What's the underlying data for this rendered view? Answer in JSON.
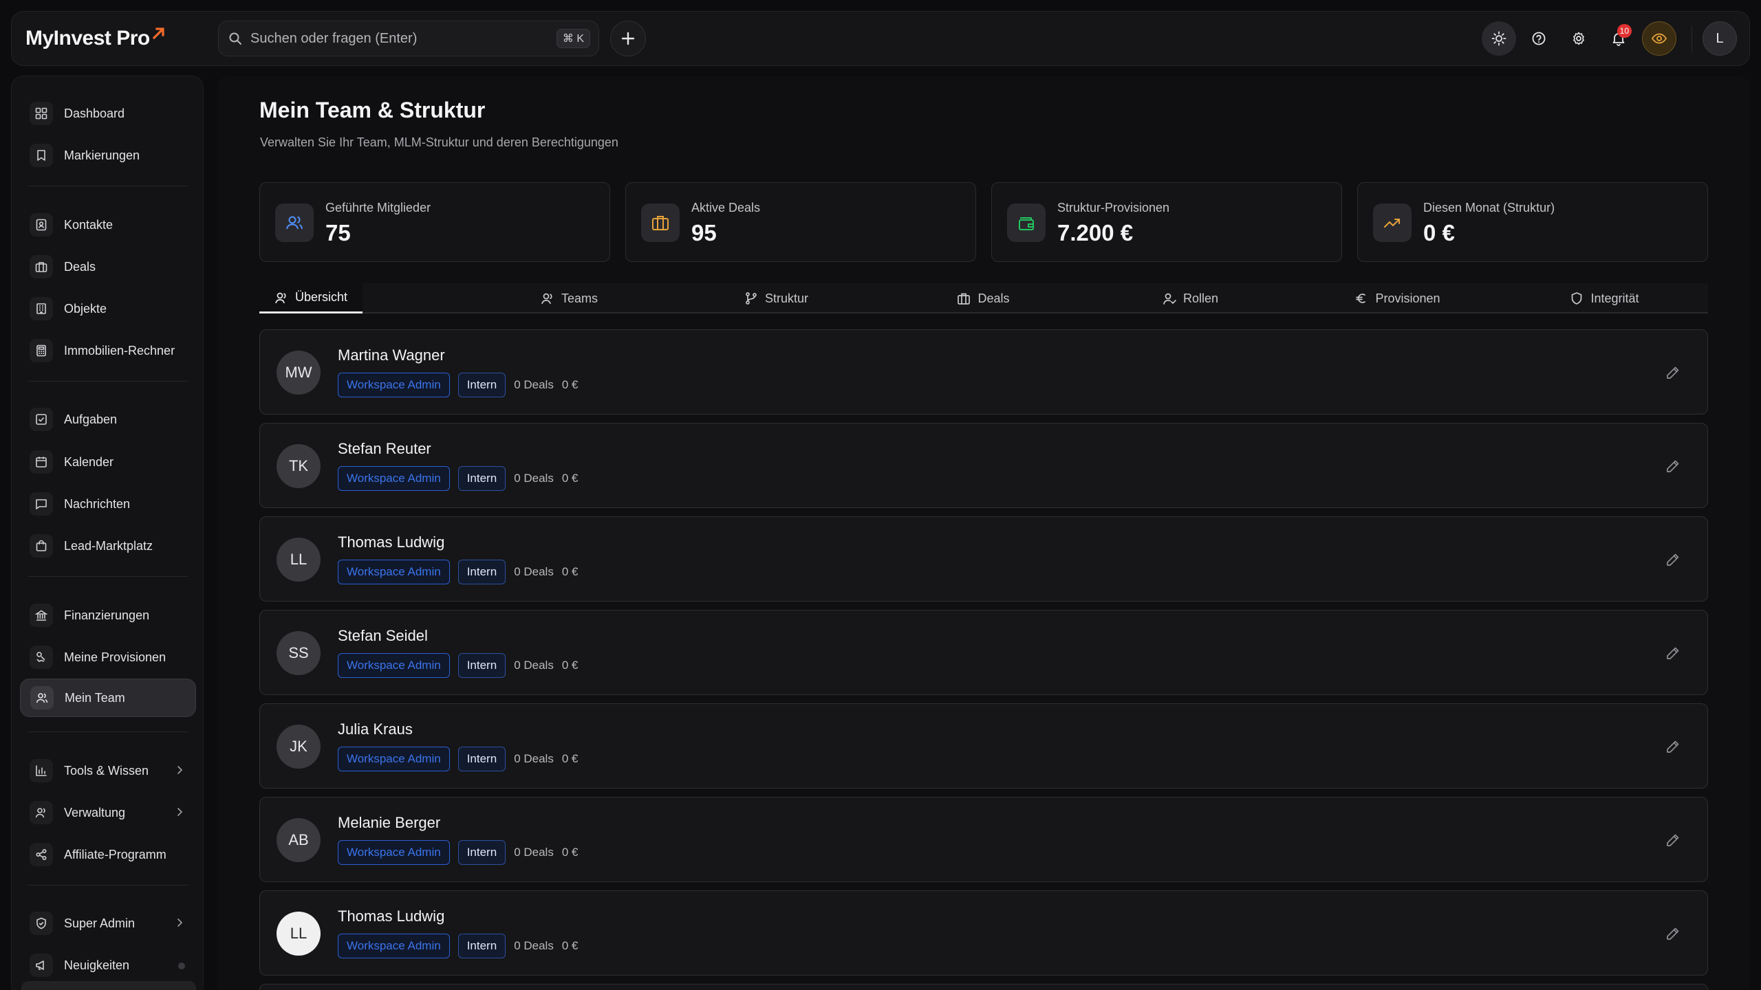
{
  "app": {
    "logo": "MyInvest Pro"
  },
  "search": {
    "placeholder": "Suchen oder fragen (Enter)",
    "shortcut": "⌘ K"
  },
  "notifications": {
    "count": "10"
  },
  "user": {
    "initial": "L"
  },
  "sidebar": {
    "items": [
      {
        "label": "Dashboard"
      },
      {
        "label": "Markierungen"
      },
      {
        "label": "Kontakte"
      },
      {
        "label": "Deals"
      },
      {
        "label": "Objekte"
      },
      {
        "label": "Immobilien-Rechner"
      },
      {
        "label": "Aufgaben"
      },
      {
        "label": "Kalender"
      },
      {
        "label": "Nachrichten"
      },
      {
        "label": "Lead-Marktplatz"
      },
      {
        "label": "Finanzierungen"
      },
      {
        "label": "Meine Provisionen"
      },
      {
        "label": "Mein Team"
      },
      {
        "label": "Tools & Wissen"
      },
      {
        "label": "Verwaltung"
      },
      {
        "label": "Affiliate-Programm"
      },
      {
        "label": "Super Admin"
      },
      {
        "label": "Neuigkeiten"
      }
    ]
  },
  "page": {
    "title": "Mein Team & Struktur",
    "subtitle": "Verwalten Sie Ihr Team, MLM-Struktur und deren Berechtigungen"
  },
  "stats": [
    {
      "label": "Geführte Mitglieder",
      "value": "75",
      "color": "#4f8ff7"
    },
    {
      "label": "Aktive Deals",
      "value": "95",
      "color": "#e8a33a"
    },
    {
      "label": "Struktur-Provisionen",
      "value": "7.200 €",
      "color": "#22c55e"
    },
    {
      "label": "Diesen Monat (Struktur)",
      "value": "0 €",
      "color": "#e8a33a"
    }
  ],
  "tabs": [
    {
      "label": "Übersicht"
    },
    {
      "label": "Teams"
    },
    {
      "label": "Struktur"
    },
    {
      "label": "Deals"
    },
    {
      "label": "Rollen"
    },
    {
      "label": "Provisionen"
    },
    {
      "label": "Integrität"
    }
  ],
  "members": [
    {
      "initials": "MW",
      "name": "Martina Wagner",
      "role": "Workspace Admin",
      "type": "Intern",
      "deals": "0 Deals",
      "amount": "0 €"
    },
    {
      "initials": "TK",
      "name": "Stefan Reuter",
      "role": "Workspace Admin",
      "type": "Intern",
      "deals": "0 Deals",
      "amount": "0 €"
    },
    {
      "initials": "LL",
      "name": "Thomas Ludwig",
      "role": "Workspace Admin",
      "type": "Intern",
      "deals": "0 Deals",
      "amount": "0 €"
    },
    {
      "initials": "SS",
      "name": "Stefan Seidel",
      "role": "Workspace Admin",
      "type": "Intern",
      "deals": "0 Deals",
      "amount": "0 €"
    },
    {
      "initials": "JK",
      "name": "Julia Kraus",
      "role": "Workspace Admin",
      "type": "Intern",
      "deals": "0 Deals",
      "amount": "0 €"
    },
    {
      "initials": "AB",
      "name": "Melanie Berger",
      "role": "Workspace Admin",
      "type": "Intern",
      "deals": "0 Deals",
      "amount": "0 €"
    },
    {
      "initials": "LL",
      "name": "Thomas Ludwig",
      "role": "Workspace Admin",
      "type": "Intern",
      "deals": "0 Deals",
      "amount": "0 €"
    }
  ],
  "colors": {
    "accent_blue": "#3b74ea",
    "brand_orange": "#f26b2a",
    "badge_red": "#e03131"
  }
}
